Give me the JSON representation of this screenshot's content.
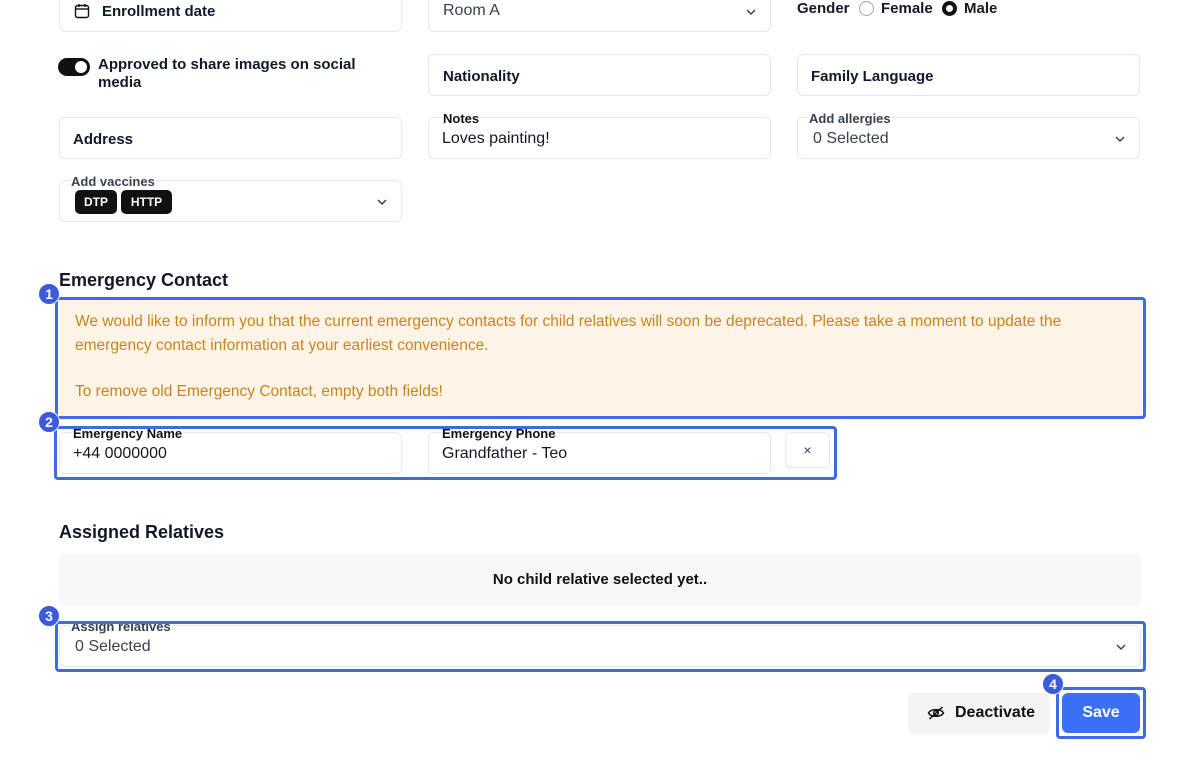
{
  "form": {
    "enrollment_date_label": "Enrollment date",
    "room_value": "Room A",
    "gender_label": "Gender",
    "gender_options": [
      "Female",
      "Male"
    ],
    "gender_selected": "Male",
    "social_media_label": "Approved to share images on social media",
    "nationality_label": "Nationality",
    "family_language_label": "Family Language",
    "address_label": "Address",
    "notes_label": "Notes",
    "notes_value": "Loves painting!",
    "allergies_label": "Add allergies",
    "allergies_value": "0 Selected",
    "vaccines_label": "Add vaccines",
    "vaccines_chips": [
      "DTP",
      "HTTP"
    ]
  },
  "emergency": {
    "title": "Emergency Contact",
    "notice_line1": "We would like to inform you that the current emergency contacts for child relatives will soon be deprecated. Please take a moment to update the",
    "notice_line2": "emergency contact information at your earliest convenience.",
    "notice_line3": "To remove old Emergency Contact, empty both fields!",
    "name_label": "Emergency Name",
    "name_value": "+44 0000000",
    "phone_label": "Emergency Phone",
    "phone_value": "Grandfather - Teo",
    "remove_glyph": "×"
  },
  "relatives": {
    "title": "Assigned Relatives",
    "empty_text": "No child relative selected yet..",
    "assign_label": "Assign relatives",
    "assign_value": "0 Selected"
  },
  "actions": {
    "deactivate_label": "Deactivate",
    "save_label": "Save"
  },
  "annotations": [
    "1",
    "2",
    "3",
    "4"
  ],
  "colors": {
    "accent": "#3b6ff5",
    "highlight": "#4169e1",
    "notice_bg": "#fdf3e6",
    "notice_text": "#c8841e"
  }
}
